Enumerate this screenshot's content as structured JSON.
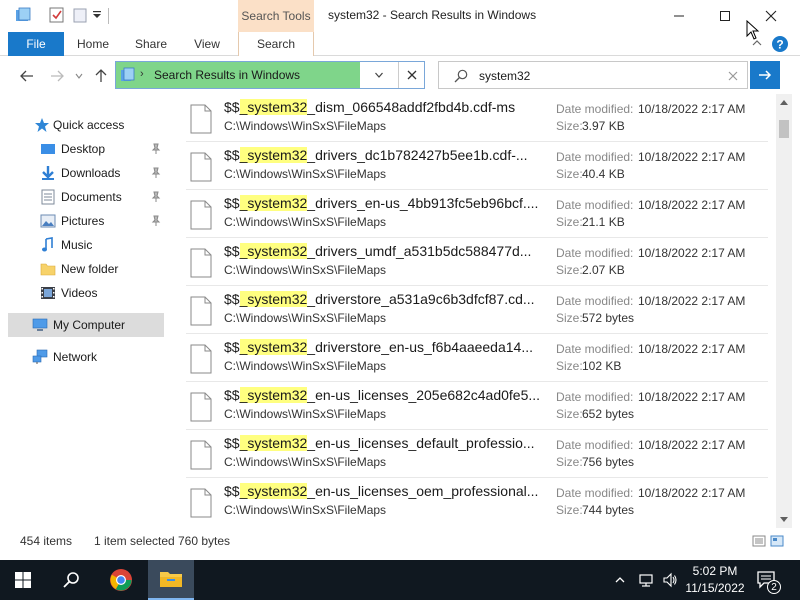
{
  "window": {
    "title": "system32 - Search Results in Windows",
    "context_tab": "Search Tools"
  },
  "ribbon": {
    "tabs": [
      {
        "label": "File"
      },
      {
        "label": "Home"
      },
      {
        "label": "Share"
      },
      {
        "label": "View"
      },
      {
        "label": "Search"
      }
    ]
  },
  "address": {
    "text": "Search Results in Windows"
  },
  "search": {
    "query": "system32"
  },
  "sidebar": {
    "items": [
      {
        "label": "Quick access",
        "icon": "star-icon"
      },
      {
        "label": "Desktop",
        "icon": "desktop-icon",
        "pinned": true
      },
      {
        "label": "Downloads",
        "icon": "downloads-icon",
        "pinned": true
      },
      {
        "label": "Documents",
        "icon": "documents-icon",
        "pinned": true
      },
      {
        "label": "Pictures",
        "icon": "pictures-icon",
        "pinned": true
      },
      {
        "label": "Music",
        "icon": "music-icon"
      },
      {
        "label": "New folder",
        "icon": "folder-icon"
      },
      {
        "label": "Videos",
        "icon": "videos-icon"
      },
      {
        "label": "My Computer",
        "icon": "computer-icon",
        "selected": true
      },
      {
        "label": "Network",
        "icon": "network-icon"
      }
    ]
  },
  "results": {
    "modified_label": "Date modified:",
    "size_label": "Size:",
    "items": [
      {
        "prefix": "$$",
        "match": "_system32",
        "rest": "_dism_066548addf2fbd4b.cdf-ms",
        "path": "C:\\Windows\\WinSxS\\FileMaps",
        "modified": "10/18/2022 2:17 AM",
        "size": "3.97 KB"
      },
      {
        "prefix": "$$",
        "match": "_system32",
        "rest": "_drivers_dc1b782427b5ee1b.cdf-...",
        "path": "C:\\Windows\\WinSxS\\FileMaps",
        "modified": "10/18/2022 2:17 AM",
        "size": "40.4 KB"
      },
      {
        "prefix": "$$",
        "match": "_system32",
        "rest": "_drivers_en-us_4bb913fc5eb96bcf....",
        "path": "C:\\Windows\\WinSxS\\FileMaps",
        "modified": "10/18/2022 2:17 AM",
        "size": "21.1 KB"
      },
      {
        "prefix": "$$",
        "match": "_system32",
        "rest": "_drivers_umdf_a531b5dc588477d...",
        "path": "C:\\Windows\\WinSxS\\FileMaps",
        "modified": "10/18/2022 2:17 AM",
        "size": "2.07 KB"
      },
      {
        "prefix": "$$",
        "match": "_system32",
        "rest": "_driverstore_a531a9c6b3dfcf87.cd...",
        "path": "C:\\Windows\\WinSxS\\FileMaps",
        "modified": "10/18/2022 2:17 AM",
        "size": "572 bytes"
      },
      {
        "prefix": "$$",
        "match": "_system32",
        "rest": "_driverstore_en-us_f6b4aaeeda14...",
        "path": "C:\\Windows\\WinSxS\\FileMaps",
        "modified": "10/18/2022 2:17 AM",
        "size": "102 KB"
      },
      {
        "prefix": "$$",
        "match": "_system32",
        "rest": "_en-us_licenses_205e682c4ad0fe5...",
        "path": "C:\\Windows\\WinSxS\\FileMaps",
        "modified": "10/18/2022 2:17 AM",
        "size": "652 bytes"
      },
      {
        "prefix": "$$",
        "match": "_system32",
        "rest": "_en-us_licenses_default_professio...",
        "path": "C:\\Windows\\WinSxS\\FileMaps",
        "modified": "10/18/2022 2:17 AM",
        "size": "756 bytes"
      },
      {
        "prefix": "$$",
        "match": "_system32",
        "rest": "_en-us_licenses_oem_professional...",
        "path": "C:\\Windows\\WinSxS\\FileMaps",
        "modified": "10/18/2022 2:17 AM",
        "size": "744 bytes"
      }
    ]
  },
  "status": {
    "count": "454 items",
    "selected": "1 item selected",
    "size": "760 bytes"
  },
  "taskbar": {
    "time": "5:02 PM",
    "date": "11/15/2022",
    "notifications": "2"
  },
  "colors": {
    "accent": "#1979ca",
    "address_bg": "#7fd58a",
    "highlight": "#ffff80",
    "context_tab": "#fbe0c7",
    "taskbar": "#101820"
  }
}
